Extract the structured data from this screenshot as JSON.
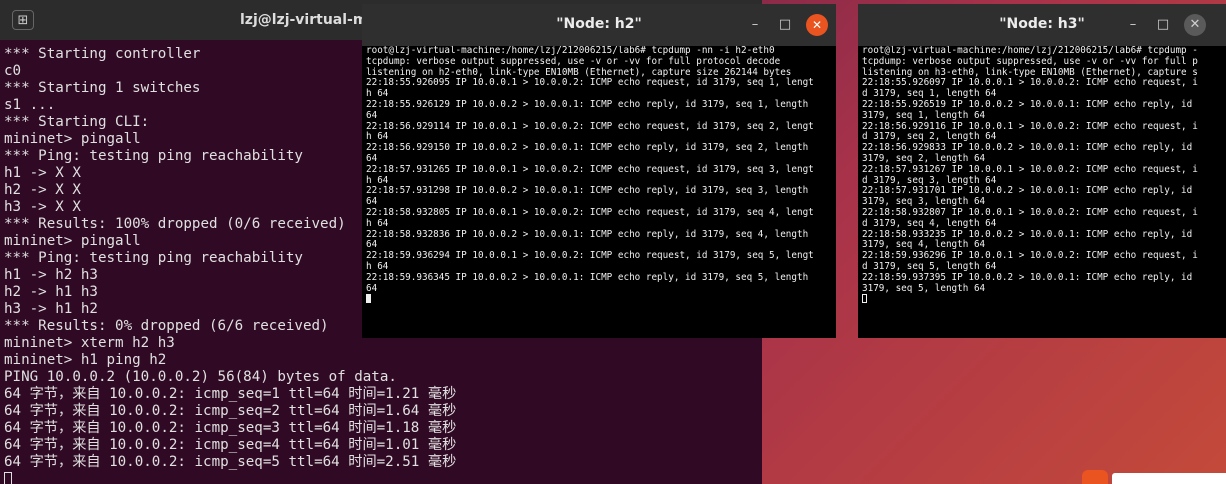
{
  "main_terminal": {
    "title": "lzj@lzj-virtual-ma",
    "lines": [
      "*** Starting controller",
      "c0",
      "*** Starting 1 switches",
      "s1 ...",
      "*** Starting CLI:",
      "mininet> pingall",
      "*** Ping: testing ping reachability",
      "h1 -> X X",
      "h2 -> X X",
      "h3 -> X X",
      "*** Results: 100% dropped (0/6 received)",
      "mininet> pingall",
      "*** Ping: testing ping reachability",
      "h1 -> h2 h3",
      "h2 -> h1 h3",
      "h3 -> h1 h2",
      "*** Results: 0% dropped (6/6 received)",
      "mininet> xterm h2 h3",
      "mininet> h1 ping h2",
      "PING 10.0.0.2 (10.0.0.2) 56(84) bytes of data.",
      "64 字节，来自 10.0.0.2: icmp_seq=1 ttl=64 时间=1.21 毫秒",
      "64 字节，来自 10.0.0.2: icmp_seq=2 ttl=64 时间=1.64 毫秒",
      "64 字节，来自 10.0.0.2: icmp_seq=3 ttl=64 时间=1.18 毫秒",
      "64 字节，来自 10.0.0.2: icmp_seq=4 ttl=64 时间=1.01 毫秒",
      "64 字节，来自 10.0.0.2: icmp_seq=5 ttl=64 时间=2.51 毫秒"
    ]
  },
  "xterm_h2": {
    "title": "\"Node: h2\"",
    "lines": [
      "root@lzj-virtual-machine:/home/lzj/212006215/lab6# tcpdump -nn -i h2-eth0",
      "tcpdump: verbose output suppressed, use -v or -vv for full protocol decode",
      "listening on h2-eth0, link-type EN10MB (Ethernet), capture size 262144 bytes",
      "22:18:55.926095 IP 10.0.0.1 > 10.0.0.2: ICMP echo request, id 3179, seq 1, lengt",
      "h 64",
      "22:18:55.926129 IP 10.0.0.2 > 10.0.0.1: ICMP echo reply, id 3179, seq 1, length",
      "64",
      "22:18:56.929114 IP 10.0.0.1 > 10.0.0.2: ICMP echo request, id 3179, seq 2, lengt",
      "h 64",
      "22:18:56.929150 IP 10.0.0.2 > 10.0.0.1: ICMP echo reply, id 3179, seq 2, length",
      "64",
      "22:18:57.931265 IP 10.0.0.1 > 10.0.0.2: ICMP echo request, id 3179, seq 3, lengt",
      "h 64",
      "22:18:57.931298 IP 10.0.0.2 > 10.0.0.1: ICMP echo reply, id 3179, seq 3, length",
      "64",
      "22:18:58.932805 IP 10.0.0.1 > 10.0.0.2: ICMP echo request, id 3179, seq 4, lengt",
      "h 64",
      "22:18:58.932836 IP 10.0.0.2 > 10.0.0.1: ICMP echo reply, id 3179, seq 4, length",
      "64",
      "22:18:59.936294 IP 10.0.0.1 > 10.0.0.2: ICMP echo request, id 3179, seq 5, lengt",
      "h 64",
      "22:18:59.936345 IP 10.0.0.2 > 10.0.0.1: ICMP echo reply, id 3179, seq 5, length",
      "64"
    ]
  },
  "xterm_h3": {
    "title": "\"Node: h3\"",
    "lines": [
      "root@lzj-virtual-machine:/home/lzj/212006215/lab6# tcpdump -",
      "tcpdump: verbose output suppressed, use -v or -vv for full p",
      "listening on h3-eth0, link-type EN10MB (Ethernet), capture s",
      "22:18:55.926097 IP 10.0.0.1 > 10.0.0.2: ICMP echo request, i",
      "d 3179, seq 1, length 64",
      "22:18:55.926519 IP 10.0.0.2 > 10.0.0.1: ICMP echo reply, id",
      "3179, seq 1, length 64",
      "22:18:56.929116 IP 10.0.0.1 > 10.0.0.2: ICMP echo request, i",
      "d 3179, seq 2, length 64",
      "22:18:56.929833 IP 10.0.0.2 > 10.0.0.1: ICMP echo reply, id",
      "3179, seq 2, length 64",
      "22:18:57.931267 IP 10.0.0.1 > 10.0.0.2: ICMP echo request, i",
      "d 3179, seq 3, length 64",
      "22:18:57.931701 IP 10.0.0.2 > 10.0.0.1: ICMP echo reply, id",
      "3179, seq 3, length 64",
      "22:18:58.932807 IP 10.0.0.1 > 10.0.0.2: ICMP echo request, i",
      "d 3179, seq 4, length 64",
      "22:18:58.933235 IP 10.0.0.2 > 10.0.0.1: ICMP echo reply, id",
      "3179, seq 4, length 64",
      "22:18:59.936296 IP 10.0.0.1 > 10.0.0.2: ICMP echo request, i",
      "d 3179, seq 5, length 64",
      "22:18:59.937395 IP 10.0.0.2 > 10.0.0.1: ICMP echo reply, id",
      "3179, seq 5, length 64"
    ]
  },
  "controls": {
    "minimize_glyph": "–",
    "maximize_glyph": "□",
    "close_glyph": "✕",
    "new_tab_glyph": "⊞"
  },
  "colors": {
    "terminal_bg": "#300a24",
    "xterm_bg": "#000000",
    "close_button": "#e95420"
  },
  "icons": [
    "new-tab-icon",
    "minimize-icon",
    "maximize-icon",
    "close-icon",
    "app-indicator-icon"
  ]
}
